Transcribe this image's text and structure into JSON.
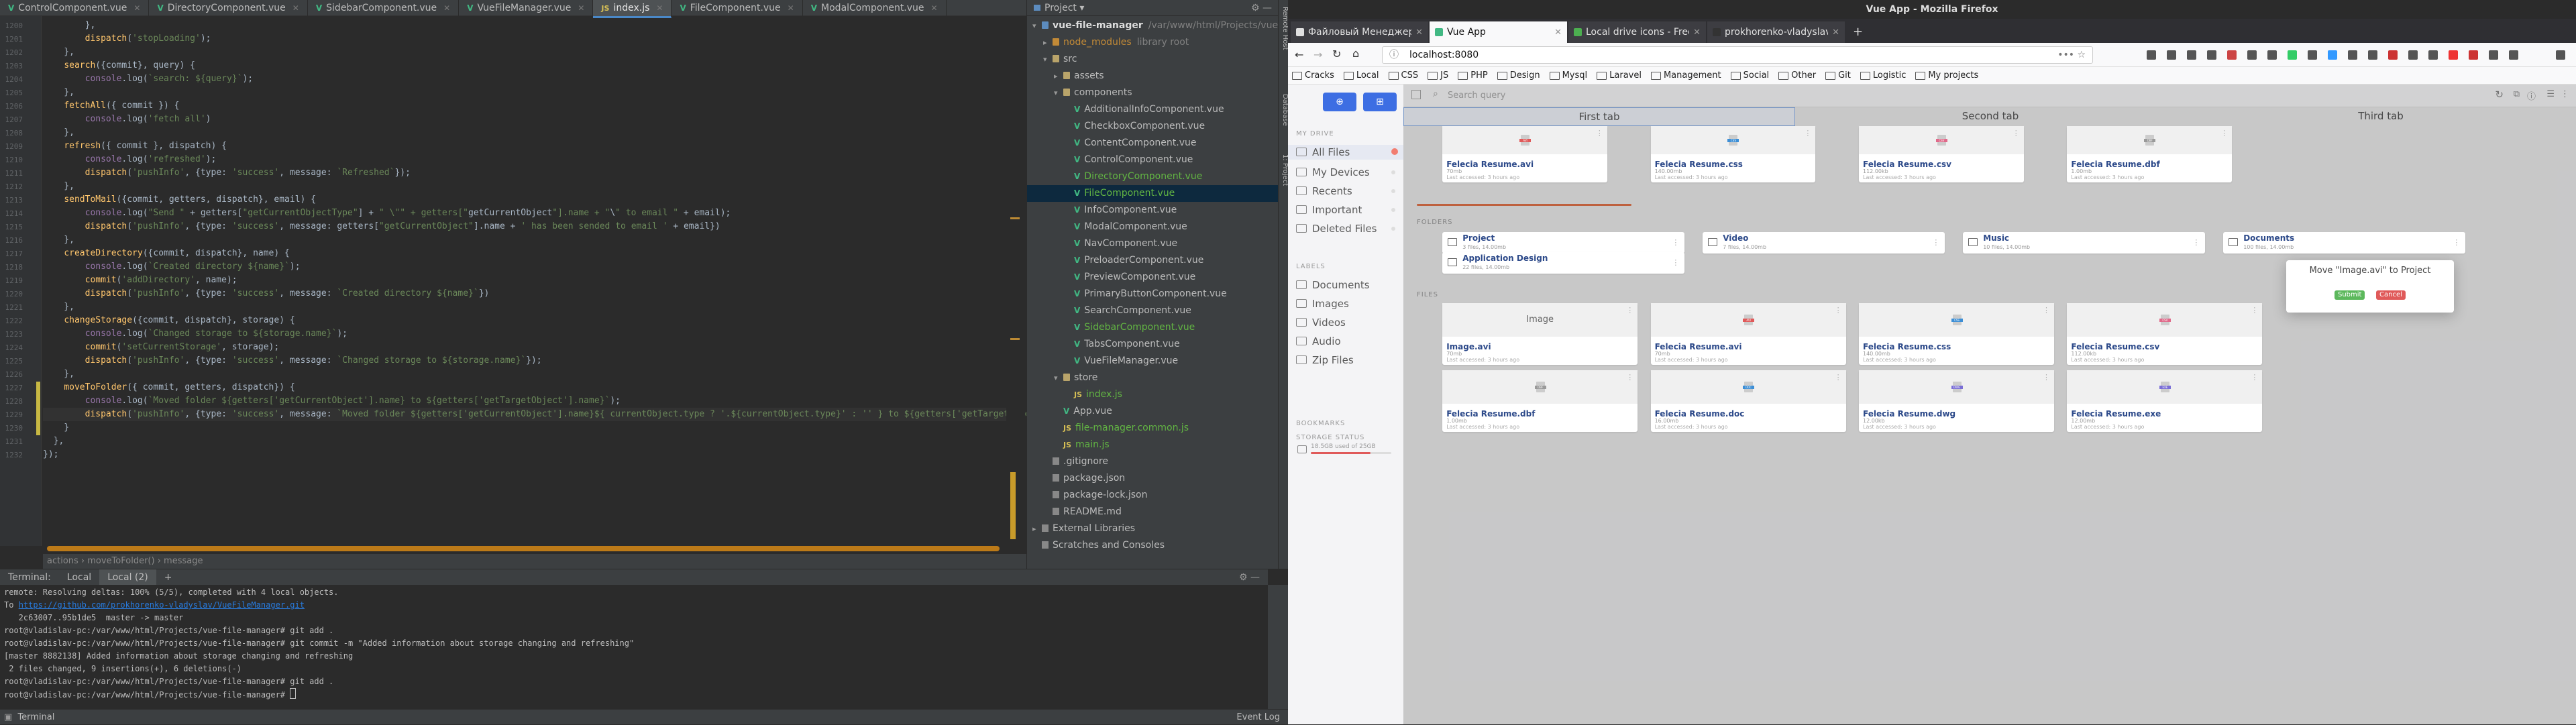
{
  "ide": {
    "tabs": [
      {
        "label": "ControlComponent.vue",
        "kind": "vue",
        "active": false
      },
      {
        "label": "DirectoryComponent.vue",
        "kind": "vue",
        "active": false
      },
      {
        "label": "SidebarComponent.vue",
        "kind": "vue",
        "active": false
      },
      {
        "label": "VueFileManager.vue",
        "kind": "vue",
        "active": false
      },
      {
        "label": "index.js",
        "kind": "js",
        "active": true
      },
      {
        "label": "FileComponent.vue",
        "kind": "vue",
        "active": false
      },
      {
        "label": "ModalComponent.vue",
        "kind": "vue",
        "active": false
      }
    ],
    "breadcrumb": "actions  ›  moveToFolder()  ›  message",
    "project_title": "Project",
    "project_tree": [
      {
        "label": "vue-file-manager",
        "extra": "/var/www/html/Projects/vue-file-manager",
        "depth": 0,
        "type": "folder",
        "arrow": "▾"
      },
      {
        "label": "node_modules",
        "extra": "library root",
        "depth": 1,
        "type": "folder-orange",
        "arrow": "▸"
      },
      {
        "label": "src",
        "extra": "",
        "depth": 1,
        "type": "folder",
        "arrow": "▾"
      },
      {
        "label": "assets",
        "extra": "",
        "depth": 2,
        "type": "folder",
        "arrow": "▸"
      },
      {
        "label": "components",
        "extra": "",
        "depth": 2,
        "type": "folder",
        "arrow": "▾"
      },
      {
        "label": "AdditionalInfoComponent.vue",
        "depth": 3,
        "type": "vue"
      },
      {
        "label": "CheckboxComponent.vue",
        "depth": 3,
        "type": "vue"
      },
      {
        "label": "ContentComponent.vue",
        "depth": 3,
        "type": "vue"
      },
      {
        "label": "ControlComponent.vue",
        "depth": 3,
        "type": "vue"
      },
      {
        "label": "DirectoryComponent.vue",
        "depth": 3,
        "type": "vue-green"
      },
      {
        "label": "FileComponent.vue",
        "depth": 3,
        "type": "vue-sel"
      },
      {
        "label": "InfoComponent.vue",
        "depth": 3,
        "type": "vue"
      },
      {
        "label": "ModalComponent.vue",
        "depth": 3,
        "type": "vue"
      },
      {
        "label": "NavComponent.vue",
        "depth": 3,
        "type": "vue"
      },
      {
        "label": "PreloaderComponent.vue",
        "depth": 3,
        "type": "vue"
      },
      {
        "label": "PreviewComponent.vue",
        "depth": 3,
        "type": "vue"
      },
      {
        "label": "PrimaryButtonComponent.vue",
        "depth": 3,
        "type": "vue"
      },
      {
        "label": "SearchComponent.vue",
        "depth": 3,
        "type": "vue"
      },
      {
        "label": "SidebarComponent.vue",
        "depth": 3,
        "type": "vue-green"
      },
      {
        "label": "TabsComponent.vue",
        "depth": 3,
        "type": "vue"
      },
      {
        "label": "VueFileManager.vue",
        "depth": 3,
        "type": "vue"
      },
      {
        "label": "store",
        "extra": "",
        "depth": 2,
        "type": "folder",
        "arrow": "▾"
      },
      {
        "label": "index.js",
        "depth": 3,
        "type": "js"
      },
      {
        "label": "App.vue",
        "depth": 2,
        "type": "vue"
      },
      {
        "label": "file-manager.common.js",
        "depth": 2,
        "type": "js"
      },
      {
        "label": "main.js",
        "depth": 2,
        "type": "js"
      },
      {
        "label": ".gitignore",
        "depth": 1,
        "type": "gen"
      },
      {
        "label": "package.json",
        "depth": 1,
        "type": "gen"
      },
      {
        "label": "package-lock.json",
        "depth": 1,
        "type": "gen"
      },
      {
        "label": "README.md",
        "depth": 1,
        "type": "gen"
      },
      {
        "label": "External Libraries",
        "depth": 0,
        "type": "lib",
        "arrow": "▸"
      },
      {
        "label": "Scratches and Consoles",
        "depth": 0,
        "type": "lib",
        "arrow": ""
      }
    ],
    "side_tools": [
      "Remote Host",
      "Database",
      "1: Project"
    ],
    "code_lines": [
      {
        "n": "",
        "t": "        },"
      },
      {
        "n": "",
        "t": "        dispatch('stopLoading');"
      },
      {
        "n": "",
        "t": "    },"
      },
      {
        "n": "",
        "t": "    search({commit}, query) {"
      },
      {
        "n": "",
        "t": "        console.log(`search: ${query}`);"
      },
      {
        "n": "",
        "t": "    },"
      },
      {
        "n": "",
        "t": "    fetchAll({ commit }) {"
      },
      {
        "n": "",
        "t": "        console.log('fetch all')"
      },
      {
        "n": "",
        "t": "    },"
      },
      {
        "n": "",
        "t": "    refresh({ commit }, dispatch) {"
      },
      {
        "n": "",
        "t": "        console.log('refreshed');"
      },
      {
        "n": "",
        "t": "        dispatch('pushInfo', {type: 'success', message: `Refreshed`});"
      },
      {
        "n": "",
        "t": "    },"
      },
      {
        "n": "",
        "t": "    sendToMail({commit, getters, dispatch}, email) {"
      },
      {
        "n": "",
        "t": "        console.log(\"Send \" + getters[\"getCurrentObjectType\"] + \" \\\"\" + getters[\"getCurrentObject\"].name + \"\\\" to email \" + email);"
      },
      {
        "n": "",
        "t": "        dispatch('pushInfo', {type: 'success', message: getters[\"getCurrentObject\"].name + ' has been sended to email ' + email})"
      },
      {
        "n": "",
        "t": "    },"
      },
      {
        "n": "",
        "t": "    createDirectory({commit, dispatch}, name) {"
      },
      {
        "n": "",
        "t": "        console.log(`Created directory ${name}`);"
      },
      {
        "n": "",
        "t": "        commit('addDirectory', name);"
      },
      {
        "n": "",
        "t": "        dispatch('pushInfo', {type: 'success', message: `Created directory ${name}`})"
      },
      {
        "n": "",
        "t": "    },"
      },
      {
        "n": "",
        "t": "    changeStorage({commit, dispatch}, storage) {"
      },
      {
        "n": "",
        "t": "        console.log(`Changed storage to ${storage.name}`);"
      },
      {
        "n": "",
        "t": "        commit('setCurrentStorage', storage);"
      },
      {
        "n": "",
        "t": "        dispatch('pushInfo', {type: 'success', message: `Changed storage to ${storage.name}`});"
      },
      {
        "n": "",
        "t": "    },"
      },
      {
        "n": "",
        "t": "    moveToFolder({ commit, getters, dispatch}) {"
      },
      {
        "n": "",
        "t": "        console.log(`Moved folder ${getters['getCurrentObject'].name} to ${getters['getTargetObject'].name}`);"
      },
      {
        "n": "",
        "t": "        dispatch('pushInfo', {type: 'success', message: `Moved folder ${getters['getCurrentObject'].name}${ currentObject.type ? '.${currentObject.type}' : '' } to ${getters['getTargetObject'].name}`});"
      },
      {
        "n": "",
        "t": "    }"
      },
      {
        "n": "",
        "t": "  },"
      },
      {
        "n": "",
        "t": "});"
      }
    ],
    "terminal_tabs": [
      "Terminal:",
      "Local",
      "Local (2)",
      "+"
    ],
    "terminal_lines": [
      "remote: Resolving deltas: 100% (5/5), completed with 4 local objects.",
      "To https://github.com/prokhorenko-vladyslav/VueFileManager.git",
      "   2c63007..95b1de5  master -> master",
      "root@vladislav-pc:/var/www/html/Projects/vue-file-manager# git add .",
      "root@vladislav-pc:/var/www/html/Projects/vue-file-manager# git commit -m \"Added information about storage changing and refreshing\"",
      "[master 8882138] Added information about storage changing and refreshing",
      " 2 files changed, 9 insertions(+), 6 deletions(-)",
      "root@vladislav-pc:/var/www/html/Projects/vue-file-manager# git add .",
      "root@vladislav-pc:/var/www/html/Projects/vue-file-manager# "
    ],
    "status_left": "Terminal",
    "status_right": "Event Log"
  },
  "firefox": {
    "window_title": "Vue App - Mozilla Firefox",
    "tabs": [
      {
        "label": "Файловый Менеджер |",
        "active": false,
        "color": "#e0e0e0"
      },
      {
        "label": "Vue App",
        "active": true,
        "color": "#41b883"
      },
      {
        "label": "Local drive icons - Free",
        "active": false,
        "color": "#4caf50"
      },
      {
        "label": "prokhorenko-vladyslav",
        "active": false,
        "color": "#333333"
      }
    ],
    "url": "localhost:8080",
    "bookmarks": [
      "Cracks",
      "Local",
      "CSS",
      "JS",
      "PHP",
      "Design",
      "Mysql",
      "Laravel",
      "Management",
      "Social",
      "Other",
      "Git",
      "Logistic",
      "My projects"
    ]
  },
  "app": {
    "search_placeholder": "Search query",
    "tabs": [
      "First tab",
      "Second tab",
      "Third tab"
    ],
    "sidebar": {
      "section_my_drive": "MY DRIVE",
      "drive_items": [
        "All Files",
        "My Devices",
        "Recents",
        "Important",
        "Deleted Files"
      ],
      "section_labels": "LABELS",
      "label_items": [
        "Documents",
        "Images",
        "Videos",
        "Audio",
        "Zip Files"
      ],
      "section_bookmarks": "BOOKMARKS",
      "section_storage": "STORAGE STATUS",
      "storage_text": "18.5GB used of 25GB"
    },
    "top_files": [
      {
        "name": "Felecia Resume.avi",
        "size": "70mb",
        "last": "Last accessed: 3 hours ago",
        "tag": "AVI",
        "color": "#e05a5a"
      },
      {
        "name": "Felecia Resume.css",
        "size": "140.00mb",
        "last": "Last accessed: 3 hours ago",
        "tag": "CSS",
        "color": "#3d8fd6"
      },
      {
        "name": "Felecia Resume.csv",
        "size": "112.00kb",
        "last": "Last accessed: 3 hours ago",
        "tag": "CSV",
        "color": "#e06a8a"
      },
      {
        "name": "Felecia Resume.dbf",
        "size": "1.00mb",
        "last": "Last accessed: 3 hours ago",
        "tag": "DBF",
        "color": "#9a9a9a"
      }
    ],
    "folders_title": "FOLDERS",
    "folders": [
      {
        "name": "Project",
        "meta": "3 files, 14.00mb"
      },
      {
        "name": "Video",
        "meta": "7 files, 14.00mb"
      },
      {
        "name": "Music",
        "meta": "10 files, 14.00mb"
      },
      {
        "name": "Documents",
        "meta": "100 files, 14.00mb"
      },
      {
        "name": "Application Design",
        "meta": "22 files, 14.00mb"
      }
    ],
    "files_title": "FILES",
    "files": [
      {
        "name": "Image.avi",
        "size": "70mb",
        "last": "Last accessed: 3 hours ago",
        "tag": "Image",
        "color": ""
      },
      {
        "name": "Felecia Resume.avi",
        "size": "70mb",
        "last": "Last accessed: 3 hours ago",
        "tag": "AVI",
        "color": "#e05a5a"
      },
      {
        "name": "Felecia Resume.css",
        "size": "140.00mb",
        "last": "Last accessed: 3 hours ago",
        "tag": "CSS",
        "color": "#3d8fd6"
      },
      {
        "name": "Felecia Resume.csv",
        "size": "112.00kb",
        "last": "Last accessed: 3 hours ago",
        "tag": "CSV",
        "color": "#e06a8a"
      },
      {
        "name": "Felecia Resume.dbf",
        "size": "1.00mb",
        "last": "Last accessed: 3 hours ago",
        "tag": "DBF",
        "color": "#9a9a9a"
      },
      {
        "name": "Felecia Resume.doc",
        "size": "16.00mb",
        "last": "Last accessed: 3 hours ago",
        "tag": "DOC",
        "color": "#3d8fd6"
      },
      {
        "name": "Felecia Resume.dwg",
        "size": "12.00kb",
        "last": "Last accessed: 3 hours ago",
        "tag": "DWG",
        "color": "#7a6ed6"
      },
      {
        "name": "Felecia Resume.exe",
        "size": "12.00mb",
        "last": "Last accessed: 3 hours ago",
        "tag": "EXE",
        "color": "#7a6ed6"
      }
    ],
    "modal": {
      "title": "Move \"Image.avi\" to Project",
      "submit": "Submit",
      "cancel": "Cancel"
    },
    "colors": {
      "primary": "#3d6ee3",
      "submit": "#5cb85c",
      "cancel": "#e05a5a",
      "accent_bar": "#e05a5a"
    }
  }
}
